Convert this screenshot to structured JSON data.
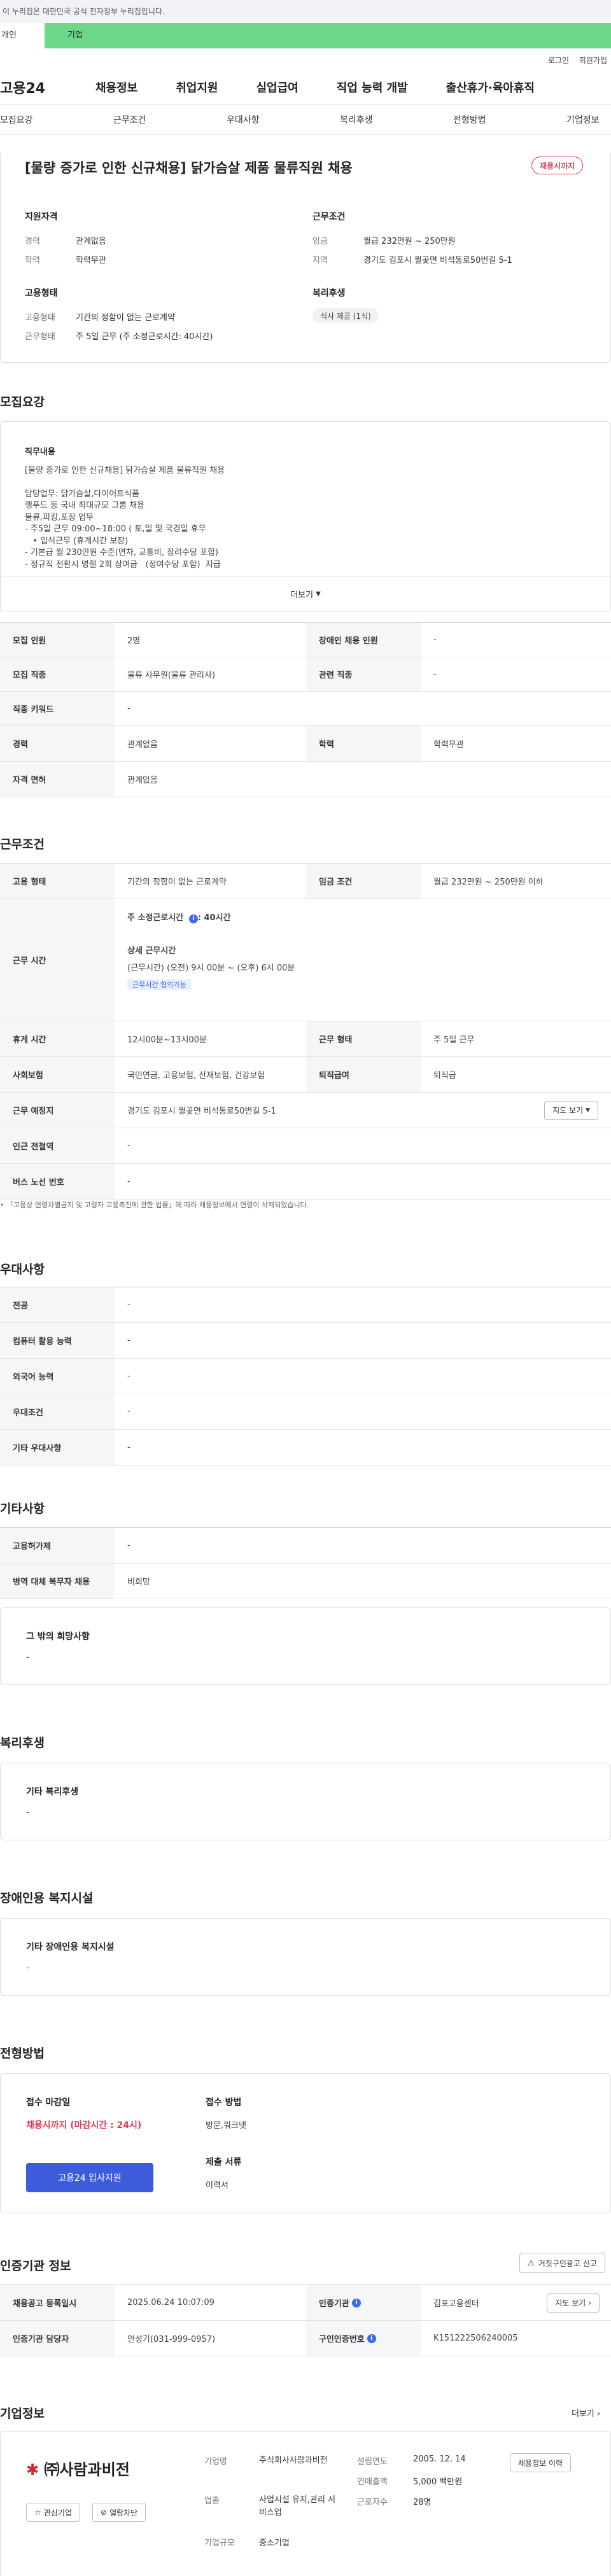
{
  "top": {
    "gov_notice": "이 누리집은 대한민국 공식 전자정부 누리집입니다.",
    "tab_person": "개인",
    "tab_company": "기업",
    "login": "로그인",
    "join": "회원가입",
    "logo": "고용24",
    "gnb": [
      "채용정보",
      "취업지원",
      "실업급여",
      "직업 능력 개발",
      "출산휴가·육아휴직"
    ],
    "subtabs": [
      "모집요강",
      "근무조건",
      "우대사항",
      "복리후생",
      "전형방법",
      "기업정보"
    ]
  },
  "summary": {
    "title": "[물량 증가로 인한 신규채용] 닭가슴살 제품 물류직원 채용",
    "status_badge": "채용시까지",
    "qualification_title": "지원자격",
    "career_label": "경력",
    "career_value": "관계없음",
    "education_label": "학력",
    "education_value": "학력무관",
    "conditions_title": "근무조건",
    "wage_label": "임금",
    "wage_value": "월급 232만원 ~ 250만원",
    "region_label": "지역",
    "region_value": "경기도 김포시 월곶면 비석동로50번길 5-1",
    "employment_title": "고용형태",
    "emp_type_label": "고용형태",
    "emp_type_value": "기간의 정함이 없는 근로계약",
    "work_type_label": "근무형태",
    "work_type_value": "주 5일 근무 (주 소정근로시간: 40시간)",
    "welfare_title": "복리후생",
    "welfare_chip": "식사 제공 (1식)"
  },
  "recruit": {
    "section_title": "모집요강",
    "duty_title": "직무내용",
    "duty_lines": [
      "[물량 증가로 인한 신규채용] 닭가슴살 제품 물류직원 채용",
      "",
      "담당업무: 닭가슴살,다이어트식품",
      "랭푸드 등 국내 최대규모 그룹 채용",
      "물류,피킹,포장 업무",
      "- 주5일 근무 09:00~18:00 ( 토,일 및 국경일 휴무",
      "   • 입식근무 (휴게시간 보장)",
      "- 기본급 월 230만원 수준(면차, 교통비, 장려수당 포함)",
      "- 정규직 전환시 명절 2회 상여금   (정여수당 포함)  지급"
    ],
    "more": "더보기",
    "rows": [
      {
        "k1": "모집 인원",
        "v1": "2명",
        "k2": "장애인 채용 인원",
        "v2": "-"
      },
      {
        "k1": "모집 직종",
        "v1": "물류 사무원(물류 관리사)",
        "k2": "관련 직종",
        "v2": "-"
      },
      {
        "k1": "직종 키워드",
        "v1": "-"
      },
      {
        "k1": "경력",
        "v1": "관계없음",
        "k2": "학력",
        "v2": "학력무관"
      },
      {
        "k1": "자격 면허",
        "v1": "관계없음"
      }
    ]
  },
  "work": {
    "section_title": "근무조건",
    "employment_label": "고용 형태",
    "employment_value": "기간의 정함이 없는 근로계약",
    "wage_label": "임금 조건",
    "wage_value": "월급 232만원 ~ 250만원 이하",
    "hours_label": "근무 시간",
    "hours_weekly": "주 소정근로시간 ",
    "hours_weekly_value": ": 40시간",
    "hours_detail_title": "상세 근무시간",
    "hours_detail": "(근무시간) (오전) 9시 00분 ~ (오후) 6시 00분",
    "hours_chip": "근무시간 협의가능",
    "break_label": "휴게 시간",
    "break_value": "12시00분~13시00분",
    "type_label": "근무 형태",
    "type_value": "주 5일 근무",
    "insurance_label": "사회보험",
    "insurance_value": "국민연금, 고용보험, 산재보험, 건강보험",
    "severance_label": "퇴직급여",
    "severance_value": "퇴직금",
    "place_label": "근무 예정지",
    "place_value": "경기도 김포시 월곶면 비석동로50번길 5-1",
    "map_button": "지도 보기",
    "subway_label": "인근 전철역",
    "subway_value": "-",
    "bus_label": "버스 노선 번호",
    "bus_value": "-",
    "note": "「고용상 연령차별금지 및 고령자 고용촉진에 관한 법률」에 따라 채용정보에서 연령이 삭제되었습니다."
  },
  "preference": {
    "section_title": "우대사항",
    "rows": [
      {
        "k": "전공",
        "v": "-"
      },
      {
        "k": "컴퓨터 활용 능력",
        "v": "-"
      },
      {
        "k": "외국어 능력",
        "v": "-"
      },
      {
        "k": "우대조건",
        "v": "-"
      },
      {
        "k": "기타 우대사항",
        "v": "-"
      }
    ]
  },
  "etc": {
    "section_title": "기타사항",
    "employ_label": "고용허가제",
    "employ_value": "-",
    "military_label": "병역 대체 복무자 채용",
    "military_value": "비희망",
    "other_title": "그 밖의 희망사항",
    "other_value": "-"
  },
  "welfare": {
    "section_title": "복리후생",
    "title": "기타 복리후생",
    "value": "-"
  },
  "disability": {
    "section_title": "장애인용 복지시설",
    "title": "기타 장애인용 복지시설",
    "value": "-"
  },
  "process": {
    "section_title": "전형방법",
    "deadline_title": "접수 마감일",
    "deadline_value": "채용시까지 (마감시간 : 24시)",
    "apply_button": "고용24 입사지원",
    "method_title": "접수 방법",
    "method_value": "방문,워크넷",
    "docs_title": "제출 서류",
    "docs_value": "이력서"
  },
  "cert": {
    "section_title": "인증기관 정보",
    "report_button": "거짓구인광고 신고",
    "reg_label": "채용공고 등록일시",
    "reg_value": "2025.06.24 10:07:09",
    "org_label": "인증기관",
    "org_value": "김포고용센터",
    "manager_label": "인증기관 담당자",
    "manager_value": "안성기(031-999-0957)",
    "notice_no_label": "구인인증번호",
    "notice_no_value": "K151222506240005",
    "map_button": "지도 보기"
  },
  "company": {
    "section_title": "기업정보",
    "more": "더보기",
    "logo_text": "㈜사람과비전",
    "interest_button": "관심기업",
    "block_button": "열람차단",
    "name_label": "기업명",
    "name_value": "주식회사사람과비전",
    "industry_label": "업종",
    "industry_value": "사업시설 유지,관리 서비스업",
    "size_label": "기업규모",
    "size_value": "중소기업",
    "founded_label": "설립연도",
    "founded_value": "2005. 12. 14",
    "sales_label": "연매출액",
    "sales_value": "5,000 백만원",
    "employees_label": "근로자수",
    "employees_value": "28명",
    "recruit_button": "채용정보 이력"
  },
  "colors": {
    "accent_green": "#6dd88a",
    "deadline_red": "#e53950",
    "apply_blue": "#3d5cdb"
  },
  "icons": [
    "chevron-down-icon",
    "info-icon",
    "star-icon",
    "block-icon",
    "siren-icon",
    "chevron-right-icon"
  ]
}
